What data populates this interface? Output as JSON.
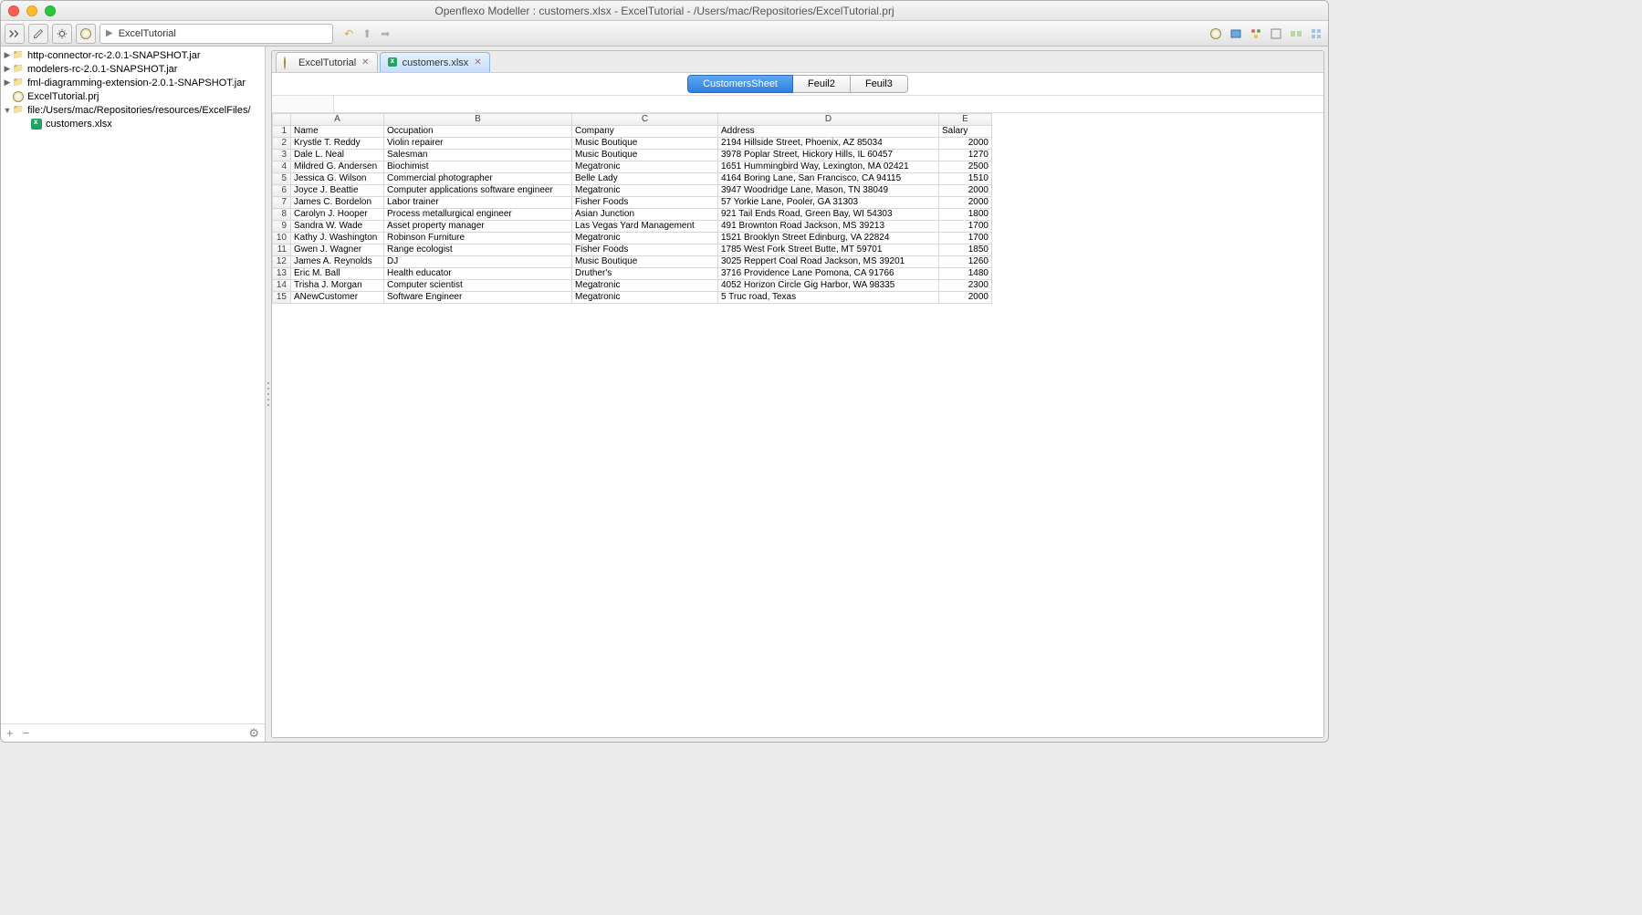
{
  "window": {
    "title": "Openflexo Modeller : customers.xlsx - ExcelTutorial - /Users/mac/Repositories/ExcelTutorial.prj"
  },
  "toolbar": {
    "breadcrumb": "ExcelTutorial"
  },
  "tree": {
    "n0": "http-connector-rc-2.0.1-SNAPSHOT.jar",
    "n1": "modelers-rc-2.0.1-SNAPSHOT.jar",
    "n2": "fml-diagramming-extension-2.0.1-SNAPSHOT.jar",
    "n3": "ExcelTutorial.prj",
    "n4": "file:/Users/mac/Repositories/resources/ExcelFiles/",
    "n5": "customers.xlsx"
  },
  "tabs": {
    "t0": "ExcelTutorial",
    "t1": "customers.xlsx"
  },
  "sheets": {
    "s0": "CustomersSheet",
    "s1": "Feuil2",
    "s2": "Feuil3"
  },
  "columns": {
    "A": "A",
    "B": "B",
    "C": "C",
    "D": "D",
    "E": "E"
  },
  "rows": [
    {
      "n": "1",
      "A": "Name",
      "B": "Occupation",
      "C": "Company",
      "D": "Address",
      "E": "Salary"
    },
    {
      "n": "2",
      "A": "Krystle T. Reddy",
      "B": "Violin repairer",
      "C": "Music Boutique",
      "D": "2194 Hillside Street, Phoenix, AZ 85034",
      "E": "2000"
    },
    {
      "n": "3",
      "A": "Dale L. Neal",
      "B": "Salesman",
      "C": "Music Boutique",
      "D": "3978 Poplar Street, Hickory Hills, IL 60457",
      "E": "1270"
    },
    {
      "n": "4",
      "A": "Mildred G. Andersen",
      "B": "Biochimist",
      "C": "Megatronic",
      "D": "1651 Hummingbird Way, Lexington, MA 02421",
      "E": "2500"
    },
    {
      "n": "5",
      "A": "Jessica G. Wilson",
      "B": "Commercial photographer",
      "C": "Belle Lady",
      "D": "4164 Boring Lane, San Francisco, CA 94115",
      "E": "1510"
    },
    {
      "n": "6",
      "A": "Joyce J. Beattie",
      "B": "Computer applications software engineer",
      "C": "Megatronic",
      "D": "3947 Woodridge Lane, Mason, TN 38049",
      "E": "2000"
    },
    {
      "n": "7",
      "A": "James C. Bordelon",
      "B": "Labor trainer",
      "C": "Fisher Foods",
      "D": "57 Yorkie Lane, Pooler, GA 31303",
      "E": "2000"
    },
    {
      "n": "8",
      "A": "Carolyn J. Hooper",
      "B": "Process metallurgical engineer",
      "C": "Asian Junction",
      "D": "921 Tail Ends Road, Green Bay, WI 54303",
      "E": "1800"
    },
    {
      "n": "9",
      "A": "Sandra W. Wade",
      "B": "Asset property manager",
      "C": "Las Vegas Yard Management",
      "D": "491 Brownton Road Jackson, MS 39213",
      "E": "1700"
    },
    {
      "n": "10",
      "A": "Kathy J. Washington",
      "B": "Robinson Furniture",
      "C": "Megatronic",
      "D": "1521 Brooklyn Street Edinburg, VA 22824",
      "E": "1700"
    },
    {
      "n": "11",
      "A": "Gwen J. Wagner",
      "B": "Range ecologist",
      "C": "Fisher Foods",
      "D": "1785 West Fork Street Butte, MT 59701",
      "E": "1850"
    },
    {
      "n": "12",
      "A": "James A. Reynolds",
      "B": "DJ",
      "C": "Music Boutique",
      "D": "3025 Reppert Coal Road Jackson, MS 39201",
      "E": "1260"
    },
    {
      "n": "13",
      "A": "Eric M. Ball",
      "B": "Health educator",
      "C": "Druther's",
      "D": "3716 Providence Lane Pomona, CA 91766",
      "E": "1480"
    },
    {
      "n": "14",
      "A": "Trisha J. Morgan",
      "B": "Computer scientist",
      "C": "Megatronic",
      "D": "4052 Horizon Circle Gig Harbor, WA 98335",
      "E": "2300"
    },
    {
      "n": "15",
      "A": "ANewCustomer",
      "B": "Software Engineer",
      "C": "Megatronic",
      "D": "5 Truc road, Texas",
      "E": "2000"
    }
  ]
}
